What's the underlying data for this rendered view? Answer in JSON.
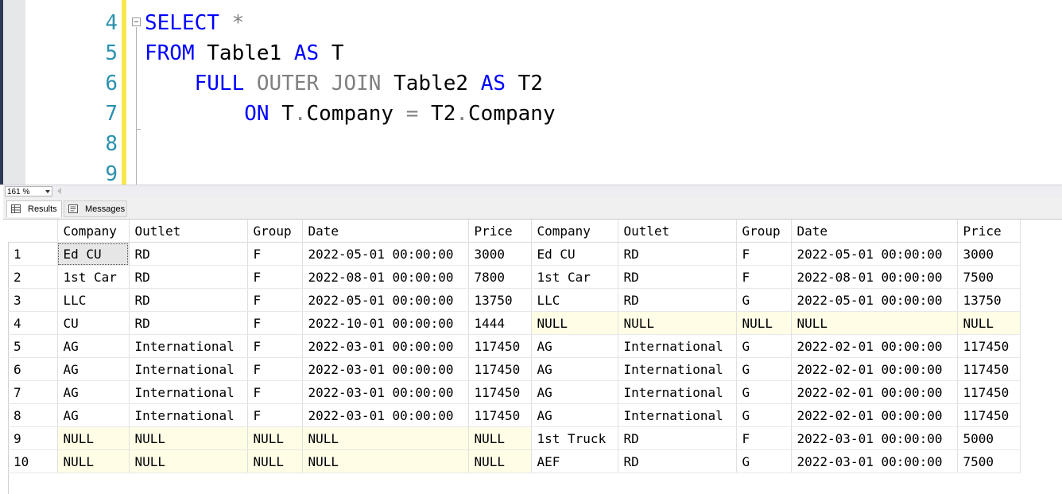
{
  "editor": {
    "line_numbers": [
      "4",
      "5",
      "6",
      "7",
      "8",
      "9"
    ],
    "lines": [
      [
        {
          "t": "SELECT",
          "c": "kw"
        },
        {
          "t": " ",
          "c": ""
        },
        {
          "t": "*",
          "c": "gray"
        }
      ],
      [
        {
          "t": "FROM",
          "c": "kw"
        },
        {
          "t": " Table1 ",
          "c": ""
        },
        {
          "t": "AS",
          "c": "kw"
        },
        {
          "t": " T",
          "c": ""
        }
      ],
      [
        {
          "t": "    ",
          "c": ""
        },
        {
          "t": "FULL",
          "c": "kw"
        },
        {
          "t": " ",
          "c": ""
        },
        {
          "t": "OUTER",
          "c": "gray"
        },
        {
          "t": " ",
          "c": ""
        },
        {
          "t": "JOIN",
          "c": "gray"
        },
        {
          "t": " Table2 ",
          "c": ""
        },
        {
          "t": "AS",
          "c": "kw"
        },
        {
          "t": " T2",
          "c": ""
        }
      ],
      [
        {
          "t": "        ",
          "c": ""
        },
        {
          "t": "ON",
          "c": "kw"
        },
        {
          "t": " T",
          "c": ""
        },
        {
          "t": ".",
          "c": "gray"
        },
        {
          "t": "Company ",
          "c": ""
        },
        {
          "t": "=",
          "c": "gray"
        },
        {
          "t": " T2",
          "c": ""
        },
        {
          "t": ".",
          "c": "gray"
        },
        {
          "t": "Company",
          "c": ""
        }
      ],
      [],
      []
    ]
  },
  "zoom": {
    "value": "161 %"
  },
  "tabs": {
    "results": "Results",
    "messages": "Messages"
  },
  "results": {
    "columns": [
      "Company",
      "Outlet",
      "Group",
      "Date",
      "Price",
      "Company",
      "Outlet",
      "Group",
      "Date",
      "Price"
    ],
    "rows": [
      [
        "1",
        "Ed CU",
        "RD",
        "F",
        "2022-05-01 00:00:00",
        "3000",
        "Ed CU",
        "RD",
        "F",
        "2022-05-01 00:00:00",
        "3000"
      ],
      [
        "2",
        "1st Car",
        "RD",
        "F",
        "2022-08-01 00:00:00",
        "7800",
        "1st Car",
        "RD",
        "F",
        "2022-08-01 00:00:00",
        "7500"
      ],
      [
        "3",
        "LLC",
        "RD",
        "F",
        "2022-05-01 00:00:00",
        "13750",
        "LLC",
        "RD",
        "G",
        "2022-05-01 00:00:00",
        "13750"
      ],
      [
        "4",
        "CU",
        "RD",
        "F",
        "2022-10-01 00:00:00",
        "1444",
        "NULL",
        "NULL",
        "NULL",
        "NULL",
        "NULL"
      ],
      [
        "5",
        "AG",
        "International",
        "F",
        "2022-03-01 00:00:00",
        "117450",
        "AG",
        "International",
        "G",
        "2022-02-01 00:00:00",
        "117450"
      ],
      [
        "6",
        "AG",
        "International",
        "F",
        "2022-03-01 00:00:00",
        "117450",
        "AG",
        "International",
        "G",
        "2022-02-01 00:00:00",
        "117450"
      ],
      [
        "7",
        "AG",
        "International",
        "F",
        "2022-03-01 00:00:00",
        "117450",
        "AG",
        "International",
        "G",
        "2022-02-01 00:00:00",
        "117450"
      ],
      [
        "8",
        "AG",
        "International",
        "F",
        "2022-03-01 00:00:00",
        "117450",
        "AG",
        "International",
        "G",
        "2022-02-01 00:00:00",
        "117450"
      ],
      [
        "9",
        "NULL",
        "NULL",
        "NULL",
        "NULL",
        "NULL",
        "1st Truck",
        "RD",
        "F",
        "2022-03-01 00:00:00",
        "5000"
      ],
      [
        "10",
        "NULL",
        "NULL",
        "NULL",
        "NULL",
        "NULL",
        "AEF",
        "RD",
        "G",
        "2022-03-01 00:00:00",
        "7500"
      ]
    ],
    "selected_cell": {
      "row": 0,
      "col": 1
    }
  }
}
